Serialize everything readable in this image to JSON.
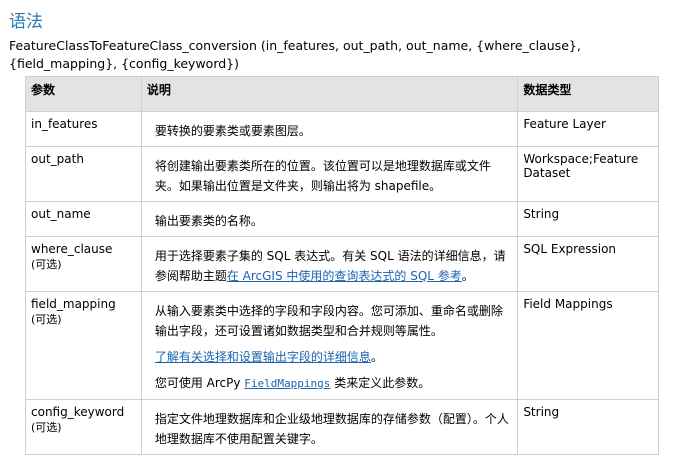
{
  "heading": "语法",
  "signature": "FeatureClassToFeatureClass_conversion (in_features, out_path, out_name, {where_clause}, {field_mapping}, {config_keyword})",
  "table": {
    "headers": [
      "参数",
      "说明",
      "数据类型"
    ],
    "optional_label": "(可选)",
    "rows": [
      {
        "param": "in_features",
        "desc": "要转换的要素类或要素图层。",
        "type": "Feature Layer"
      },
      {
        "param": "out_path",
        "desc": "将创建输出要素类所在的位置。该位置可以是地理数据库或文件夹。如果输出位置是文件夹，则输出将为 shapefile。",
        "type": "Workspace;Feature Dataset"
      },
      {
        "param": "out_name",
        "desc": "输出要素类的名称。",
        "type": "String"
      },
      {
        "param": "where_clause",
        "desc_prefix": "用于选择要素子集的 SQL 表达式。有关 SQL 语法的详细信息，请参阅帮助主题",
        "desc_link": "在 ArcGIS 中使用的查询表达式的 SQL 参考",
        "desc_suffix": "。",
        "type": "SQL Expression"
      },
      {
        "param": "field_mapping",
        "desc_p1": "从输入要素类中选择的字段和字段内容。您可添加、重命名或删除输出字段，还可设置诸如数据类型和合并规则等属性。",
        "desc_link": "了解有关选择和设置输出字段的详细信息",
        "desc_link_suffix": "。",
        "desc_p3_prefix": "您可使用 ArcPy ",
        "desc_p3_code": "FieldMappings",
        "desc_p3_suffix": " 类来定义此参数。",
        "type": "Field Mappings"
      },
      {
        "param": "config_keyword",
        "desc": "指定文件地理数据库和企业级地理数据库的存储参数（配置）。个人地理数据库不使用配置关键字。",
        "type": "String"
      }
    ]
  }
}
